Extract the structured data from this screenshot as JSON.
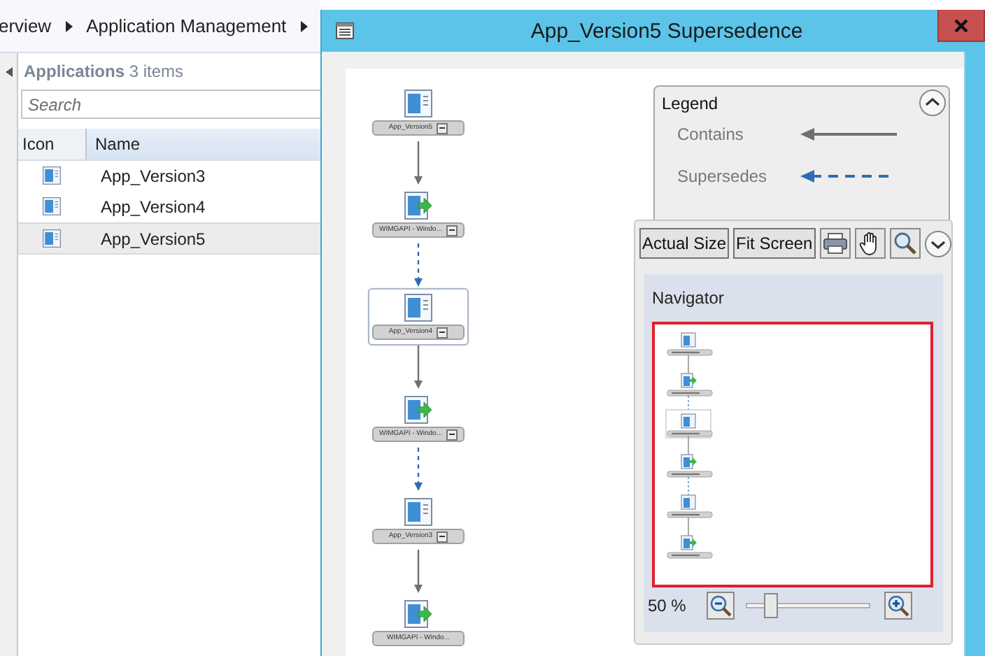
{
  "breadcrumb": {
    "items": [
      "erview",
      "Application Management"
    ]
  },
  "applications": {
    "title": "Applications",
    "count": "3 items",
    "search": {
      "placeholder": "Search"
    },
    "columns": [
      "Icon",
      "Name"
    ],
    "rows": [
      {
        "name": "App_Version3",
        "selected": false
      },
      {
        "name": "App_Version4",
        "selected": false
      },
      {
        "name": "App_Version5",
        "selected": true
      }
    ]
  },
  "dialog": {
    "title": "App_Version5 Supersedence",
    "diagram": {
      "nodes": [
        {
          "kind": "application",
          "label": "App_Version5",
          "selected": false,
          "collapsible": true
        },
        {
          "kind": "deployment",
          "label": "WIMGAPI - Windo...",
          "selected": false,
          "collapsible": true
        },
        {
          "kind": "application",
          "label": "App_Version4",
          "selected": true,
          "collapsible": true
        },
        {
          "kind": "deployment",
          "label": "WIMGAPI - Windo...",
          "selected": false,
          "collapsible": true
        },
        {
          "kind": "application",
          "label": "App_Version3",
          "selected": false,
          "collapsible": true
        },
        {
          "kind": "deployment",
          "label": "WIMGAPI - Windo...",
          "selected": false,
          "collapsible": false
        }
      ],
      "links": [
        {
          "kind": "contains"
        },
        {
          "kind": "supersedes"
        },
        {
          "kind": "contains"
        },
        {
          "kind": "supersedes"
        },
        {
          "kind": "contains"
        }
      ]
    },
    "legend": {
      "title": "Legend",
      "expanded": true,
      "items": [
        {
          "kind": "contains",
          "label": "Contains"
        },
        {
          "kind": "supersedes",
          "label": "Supersedes"
        }
      ]
    },
    "toolbar": {
      "buttons": [
        "Actual Size",
        "Fit Screen"
      ]
    },
    "navigator": {
      "title": "Navigator",
      "zoom_label": "50 %",
      "zoom": {
        "level": 0.2
      }
    }
  }
}
